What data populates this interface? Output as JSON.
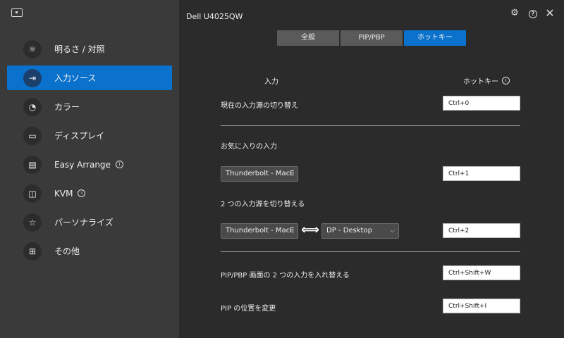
{
  "window": {
    "title": "Dell U4025QW"
  },
  "sidebar": {
    "items": [
      {
        "label": "明るさ / 対照",
        "icon": "sun-icon",
        "info": false
      },
      {
        "label": "入力ソース",
        "icon": "input-icon",
        "info": false,
        "active": true
      },
      {
        "label": "カラー",
        "icon": "palette-icon",
        "info": false
      },
      {
        "label": "ディスプレイ",
        "icon": "monitor-icon",
        "info": false
      },
      {
        "label": "Easy Arrange",
        "icon": "layout-icon",
        "info": true
      },
      {
        "label": "KVM",
        "icon": "kvm-icon",
        "info": true
      },
      {
        "label": "パーソナライズ",
        "icon": "star-icon",
        "info": false
      },
      {
        "label": "その他",
        "icon": "others-icon",
        "info": false
      }
    ]
  },
  "tabs": [
    {
      "label": "全般"
    },
    {
      "label": "PIP/PBP"
    },
    {
      "label": "ホットキー",
      "active": true
    }
  ],
  "headers": {
    "input": "入力",
    "hotkey": "ホットキー"
  },
  "rows": {
    "switch_source": {
      "label": "現在の入力源の切り替え",
      "hotkey": "Ctrl+0"
    },
    "favorite": {
      "label": "お気に入りの入力",
      "select": "Thunderbolt - MacE",
      "hotkey": "Ctrl+1"
    },
    "toggle_two": {
      "label": "2 つの入力源を切り替える",
      "select_a": "Thunderbolt - MacE",
      "select_b": "DP - Desktop",
      "hotkey": "Ctrl+2"
    },
    "pip_swap": {
      "label": "PIP/PBP 画面の 2 つの入力を入れ替える",
      "hotkey": "Ctrl+Shift+W"
    },
    "pip_position": {
      "label": "PIP の位置を変更",
      "hotkey": "Ctrl+Shift+I"
    }
  },
  "icons": {
    "settings": "gear-icon",
    "help": "help-icon",
    "close": "close-icon"
  },
  "colors": {
    "accent": "#0a72cc",
    "sidebar": "#3a3a3a",
    "main": "#2b2b2b"
  }
}
